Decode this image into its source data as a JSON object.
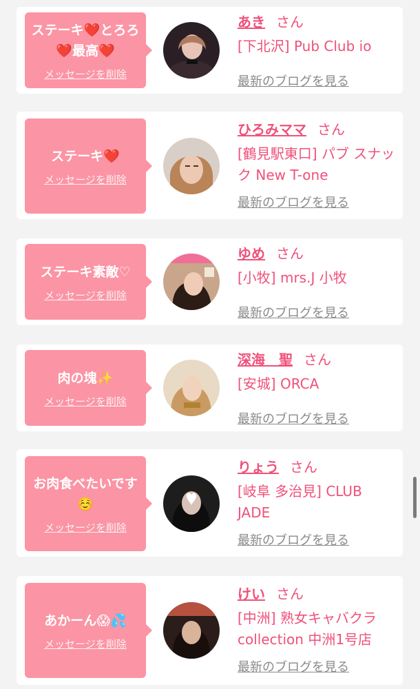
{
  "items": [
    {
      "comment_lines": [
        "ステーキ❤️とろろ",
        "❤️最高❤️"
      ],
      "delete_label": "メッセージを削除",
      "name": "あき",
      "honorific": "さん",
      "shop": "[下北沢] Pub Club io",
      "blog_link": "最新のブログを見る",
      "avatar_icon": "profile-photo"
    },
    {
      "comment_lines": [
        "ステーキ❤️"
      ],
      "delete_label": "メッセージを削除",
      "name": "ひろみママ",
      "honorific": "さん",
      "shop": "[鶴見駅東口] パブ スナック New T-one",
      "blog_link": "最新のブログを見る",
      "avatar_icon": "profile-photo"
    },
    {
      "comment_lines": [
        "ステーキ素敵♡"
      ],
      "delete_label": "メッセージを削除",
      "name": "ゆめ",
      "honorific": "さん",
      "shop": "[小牧] mrs.J 小牧",
      "blog_link": "最新のブログを見る",
      "avatar_icon": "profile-photo"
    },
    {
      "comment_lines": [
        "肉の塊✨"
      ],
      "delete_label": "メッセージを削除",
      "name": "深海　聖",
      "honorific": "さん",
      "shop": "[安城] ORCA",
      "blog_link": "最新のブログを見る",
      "avatar_icon": "profile-photo"
    },
    {
      "comment_lines": [
        "お肉食べたいです",
        "☺️"
      ],
      "delete_label": "メッセージを削除",
      "name": "りょう",
      "honorific": "さん",
      "shop": "[岐阜 多治見] CLUB JADE",
      "blog_link": "最新のブログを見る",
      "avatar_icon": "profile-photo"
    },
    {
      "comment_lines": [
        "あかーん😱💦"
      ],
      "delete_label": "メッセージを削除",
      "name": "けい",
      "honorific": "さん",
      "shop": "[中洲] 熟女キャバクラ collection 中洲1号店",
      "blog_link": "最新のブログを見る",
      "avatar_icon": "profile-photo"
    }
  ],
  "colors": {
    "bubble": "#fb94a4",
    "name": "#f0507a",
    "link_gray": "#8a8a8a",
    "background": "#f3f3f3"
  }
}
